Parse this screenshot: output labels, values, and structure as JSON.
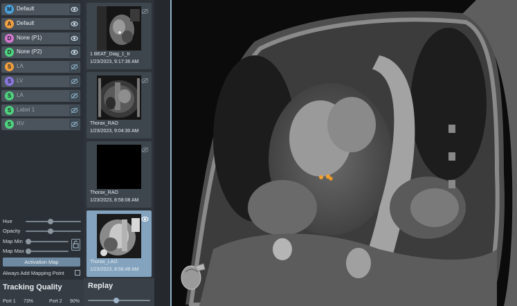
{
  "layers": [
    {
      "badge": "M",
      "label": "Default",
      "color": "#4aa3df",
      "dim": false
    },
    {
      "badge": "A",
      "label": "Default",
      "color": "#f0a040",
      "dim": false
    },
    {
      "badge": "D",
      "label": "None (P1)",
      "color": "#d678d0",
      "dim": false
    },
    {
      "badge": "D",
      "label": "None (P2)",
      "color": "#4fd37f",
      "dim": false
    },
    {
      "badge": "S",
      "label": "LA",
      "color": "#f0a040",
      "dim": true
    },
    {
      "badge": "S",
      "label": "LV",
      "color": "#8a78e0",
      "dim": true
    },
    {
      "badge": "S",
      "label": "LA",
      "color": "#4fd37f",
      "dim": true
    },
    {
      "badge": "S",
      "label": "Label 1",
      "color": "#4fd37f",
      "dim": true
    },
    {
      "badge": "S",
      "label": "RV",
      "color": "#4fd37f",
      "dim": true
    }
  ],
  "controls": {
    "hue_label": "Hue",
    "opacity_label": "Opacity",
    "map_min_label": "Map Min",
    "map_max_label": "Map Max",
    "hue_level": 0.45,
    "opacity_level": 0.45,
    "activation_map_label": "Activation Map",
    "always_add_label": "Always Add Mapping Point"
  },
  "tracking": {
    "title": "Tracking Quality",
    "port1_label": "Port 1",
    "port1_value": "73%",
    "port2_label": "Port 2",
    "port2_value": "90%"
  },
  "series": [
    {
      "name": "1 BEAT_Diag_1_tr",
      "time": "1/23/2023, 9:17:36 AM",
      "selected": false
    },
    {
      "name": "Thorax_RAO",
      "time": "1/23/2023, 9:04:30 AM",
      "selected": false
    },
    {
      "name": "Thorax_RAO",
      "time": "1/23/2023, 8:58:08 AM",
      "selected": false
    },
    {
      "name": "Thorax_LAO",
      "time": "1/23/2023, 8:56:49 AM",
      "selected": true
    }
  ],
  "replay": {
    "title": "Replay",
    "level": 0.45
  },
  "icons": {
    "eye": "eye-icon",
    "eye_off": "eye-off-icon",
    "lock": "lock-icon"
  }
}
